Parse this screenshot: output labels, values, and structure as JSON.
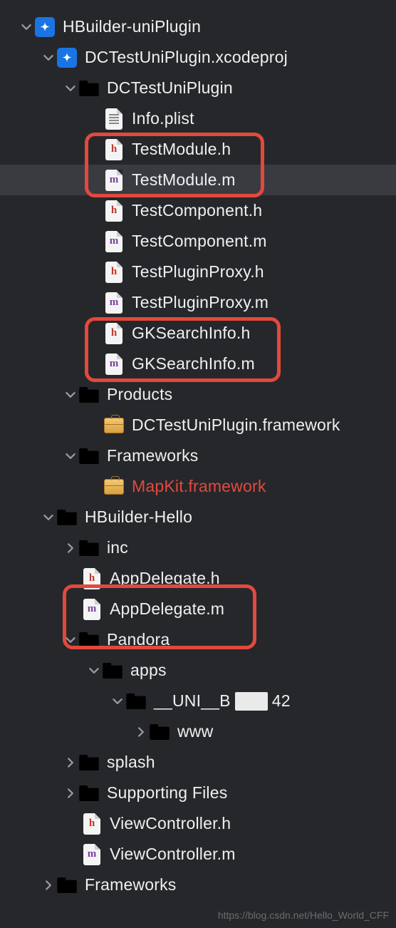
{
  "root": {
    "label": "HBuilder-uniPlugin",
    "children": {
      "xcodeproj": {
        "label": "DCTestUniPlugin.xcodeproj",
        "plugin_folder": {
          "label": "DCTestUniPlugin",
          "files": {
            "info_plist": "Info.plist",
            "testmodule_h": "TestModule.h",
            "testmodule_m": "TestModule.m",
            "testcomponent_h": "TestComponent.h",
            "testcomponent_m": "TestComponent.m",
            "testpluginproxy_h": "TestPluginProxy.h",
            "testpluginproxy_m": "TestPluginProxy.m",
            "gksearchinfo_h": "GKSearchInfo.h",
            "gksearchinfo_m": "GKSearchInfo.m"
          }
        },
        "products": {
          "label": "Products",
          "framework": "DCTestUniPlugin.framework"
        },
        "frameworks": {
          "label": "Frameworks",
          "mapkit": "MapKit.framework"
        }
      },
      "hbuilder_hello": {
        "label": "HBuilder-Hello",
        "inc": "inc",
        "appdelegate_h": "AppDelegate.h",
        "appdelegate_m": "AppDelegate.m",
        "pandora": {
          "label": "Pandora",
          "apps": {
            "label": "apps",
            "uni": {
              "prefix": "__UNI__B",
              "suffix": "42",
              "www": "www"
            }
          }
        },
        "splash": "splash",
        "supporting_files": "Supporting Files",
        "viewcontroller_h": "ViewController.h",
        "viewcontroller_m": "ViewController.m"
      },
      "frameworks_bottom": "Frameworks"
    }
  },
  "watermark": "https://blog.csdn.net/Hello_World_CFF"
}
